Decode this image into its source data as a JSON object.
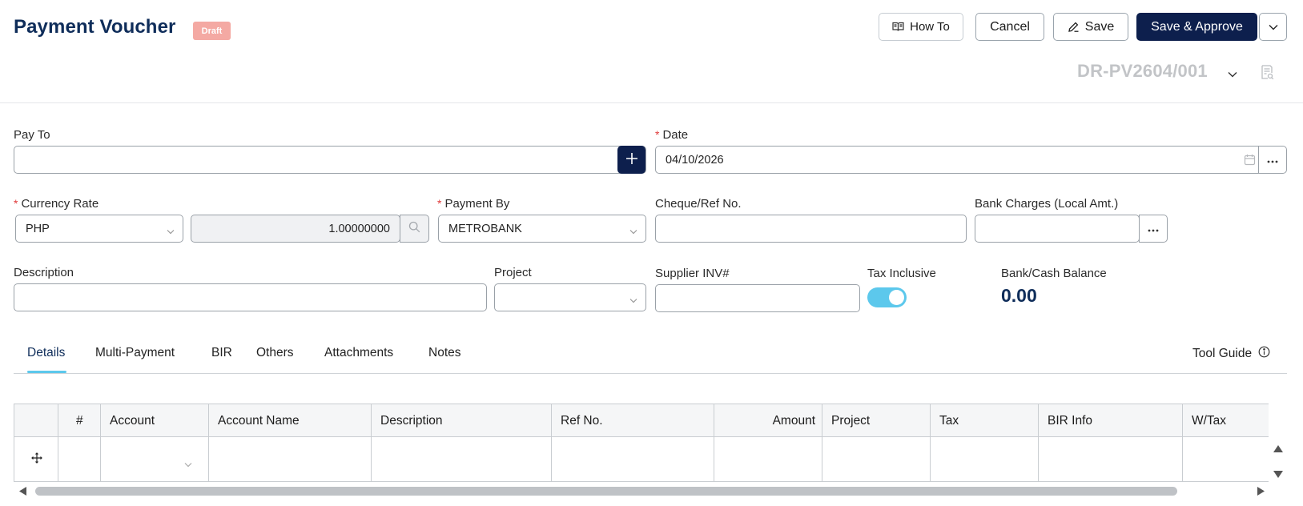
{
  "header": {
    "title": "Payment Voucher",
    "status_badge": "Draft",
    "buttons": {
      "how_to": "How To",
      "cancel": "Cancel",
      "save": "Save",
      "save_approve": "Save & Approve"
    },
    "doc_number": "DR-PV2604/001"
  },
  "form": {
    "pay_to": {
      "label": "Pay To",
      "value": ""
    },
    "date": {
      "label": "Date",
      "value": "04/10/2026",
      "required": true
    },
    "currency_rate": {
      "label": "Currency Rate",
      "currency": "PHP",
      "rate": "1.00000000",
      "required": true
    },
    "payment_by": {
      "label": "Payment By",
      "value": "METROBANK",
      "required": true
    },
    "cheque_ref": {
      "label": "Cheque/Ref No.",
      "value": ""
    },
    "bank_charges": {
      "label": "Bank Charges (Local Amt.)",
      "value": ""
    },
    "description": {
      "label": "Description",
      "value": ""
    },
    "project": {
      "label": "Project",
      "value": ""
    },
    "supplier_inv": {
      "label": "Supplier INV#",
      "value": ""
    },
    "tax_inclusive": {
      "label": "Tax Inclusive",
      "on": true
    },
    "balance": {
      "label": "Bank/Cash Balance",
      "value": "0.00"
    }
  },
  "tabs": [
    {
      "label": "Details",
      "active": true
    },
    {
      "label": "Multi-Payment"
    },
    {
      "label": "BIR"
    },
    {
      "label": "Others"
    },
    {
      "label": "Attachments"
    },
    {
      "label": "Notes"
    }
  ],
  "tool_guide": "Tool Guide",
  "grid": {
    "columns": [
      "#",
      "Account",
      "Account Name",
      "Description",
      "Ref No.",
      "Amount",
      "Project",
      "Tax",
      "BIR Info",
      "W/Tax"
    ]
  },
  "colors": {
    "primary": "#0d1f4d",
    "title": "#0f2d5a",
    "accent": "#5cc8ec",
    "badge": "#f4a9a3",
    "required": "#e03a3a"
  },
  "icons": [
    "book-icon",
    "pencil-icon",
    "chevron-down-icon",
    "document-search-icon",
    "plus-icon",
    "calendar-icon",
    "ellipsis-icon",
    "search-icon",
    "info-icon",
    "move-icon"
  ]
}
